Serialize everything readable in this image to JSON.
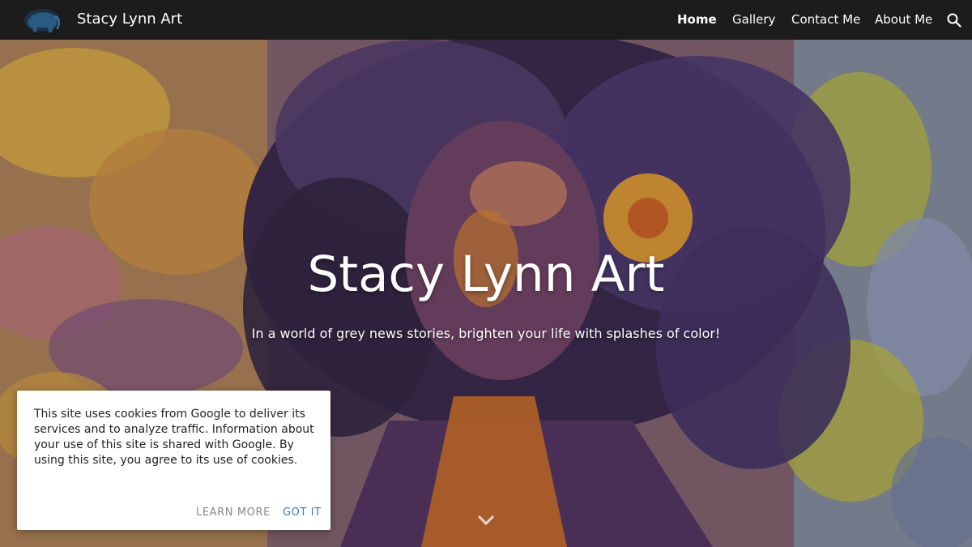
{
  "header": {
    "site_title": "Stacy Lynn Art",
    "nav": [
      {
        "label": "Home",
        "active": true
      },
      {
        "label": "Gallery",
        "active": false
      },
      {
        "label": "Contact Me",
        "active": false
      },
      {
        "label": "About Me",
        "active": false
      }
    ],
    "icons": {
      "logo": "elephant-logo-icon",
      "search": "search-icon"
    }
  },
  "hero": {
    "title": "Stacy Lynn Art",
    "subtitle": "In a world of grey news stories, brighten your life with splashes of color!",
    "scroll_icon": "chevron-down-icon"
  },
  "cookie_banner": {
    "text": "This site uses cookies from Google to deliver its services and to analyze traffic. Information about your use of this site is shared with Google. By using this site, you agree to its use of cookies.",
    "learn_more_label": "LEARN MORE",
    "got_it_label": "GOT IT"
  },
  "colors": {
    "topbar": "#1c1c1c",
    "link_accent": "#3b78c4",
    "painting_purple": "#6b4a78",
    "painting_yellow": "#d9b73a",
    "painting_orange": "#e88a2e"
  }
}
